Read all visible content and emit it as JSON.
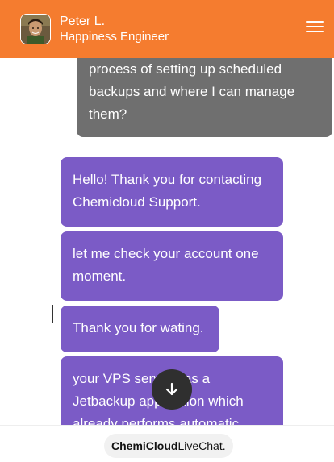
{
  "theme": {
    "accent": "#f57c2f",
    "agent_bubble": "#7b5bc6",
    "user_bubble": "#6f6f6f",
    "scroll_button": "#2f2f2f"
  },
  "header": {
    "agent_name": "Peter L.",
    "agent_role": "Happiness Engineer",
    "menu_icon": "hamburger-menu-icon"
  },
  "messages": [
    {
      "from": "user",
      "lines": [
        "process of setting up scheduled",
        "backups and where I can manage",
        "them?"
      ]
    },
    {
      "from": "agent",
      "lines": [
        "Hello! Thank you for contacting",
        "Chemicloud Support."
      ]
    },
    {
      "from": "agent",
      "lines": [
        "let me check your account one",
        "moment."
      ]
    },
    {
      "from": "agent",
      "lines": [
        "Thank you for wating."
      ]
    },
    {
      "from": "agent",
      "lines": [
        "your VPS server has a",
        "Jetbackup application which",
        "already performs automatic"
      ]
    }
  ],
  "scroll_button": {
    "icon": "arrow-down-icon"
  },
  "footer": {
    "brand_bold": "ChemiCloud",
    "brand_regular": "LiveChat."
  }
}
